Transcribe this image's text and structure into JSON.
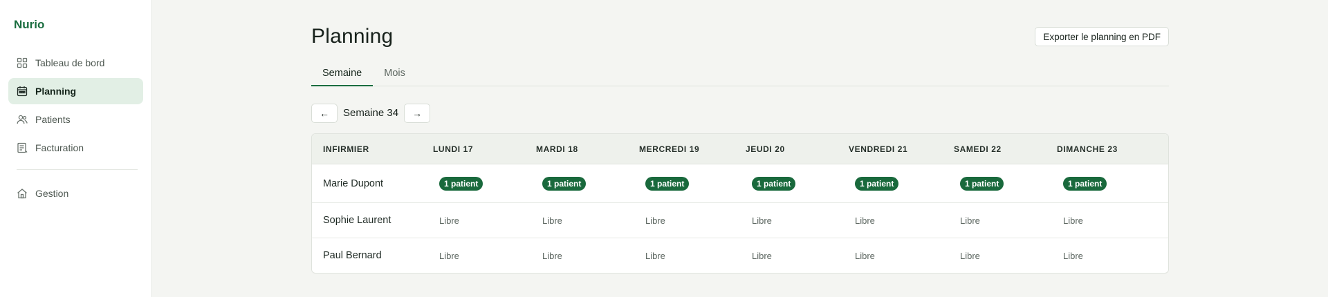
{
  "sidebar": {
    "brand": "Nurio",
    "items": [
      {
        "label": "Tableau de bord",
        "icon": "dashboard-icon"
      },
      {
        "label": "Planning",
        "icon": "calendar-icon",
        "active": true
      },
      {
        "label": "Patients",
        "icon": "users-icon"
      },
      {
        "label": "Facturation",
        "icon": "invoice-icon"
      }
    ],
    "secondary": [
      {
        "label": "Gestion",
        "icon": "home-icon"
      }
    ]
  },
  "header": {
    "title": "Planning",
    "export_label": "Exporter le planning en PDF"
  },
  "tabs": [
    {
      "label": "Semaine",
      "active": true
    },
    {
      "label": "Mois",
      "active": false
    }
  ],
  "week_nav": {
    "prev": "←",
    "label": "Semaine 34",
    "next": "→"
  },
  "table": {
    "headers": [
      "INFIRMIER",
      "LUNDI 17",
      "MARDI 18",
      "MERCREDI 19",
      "JEUDI 20",
      "VENDREDI 21",
      "SAMEDI 22",
      "DIMANCHE 23"
    ],
    "rows": [
      {
        "name": "Marie Dupont",
        "cells": [
          "1 patient",
          "1 patient",
          "1 patient",
          "1 patient",
          "1 patient",
          "1 patient",
          "1 patient"
        ]
      },
      {
        "name": "Sophie Laurent",
        "cells": [
          "Libre",
          "Libre",
          "Libre",
          "Libre",
          "Libre",
          "Libre",
          "Libre"
        ]
      },
      {
        "name": "Paul Bernard",
        "cells": [
          "Libre",
          "Libre",
          "Libre",
          "Libre",
          "Libre",
          "Libre",
          "Libre"
        ]
      }
    ]
  },
  "colors": {
    "brand": "#1a6d3f",
    "badge": "#19693c",
    "active_nav_bg": "#e2efe5",
    "background": "#f4f5f2"
  }
}
